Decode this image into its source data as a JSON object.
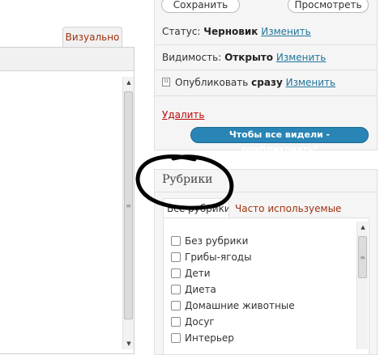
{
  "editor": {
    "tab_visual": "Визуально"
  },
  "publish": {
    "save_label": "Сохранить",
    "preview_label": "Просмотреть",
    "status_label": "Статус:",
    "status_value": "Черновик",
    "status_edit": "Изменить",
    "visibility_label": "Видимость:",
    "visibility_value": "Открыто",
    "visibility_edit": "Изменить",
    "publish_label": "Опубликовать",
    "publish_value": "сразу",
    "publish_edit": "Изменить",
    "delete_label": "Удалить",
    "publish_button": "Чтобы все видели - опубликовать!"
  },
  "categories": {
    "title": "Рубрики",
    "tab_all": "Все рубрики",
    "tab_popular": "Часто используемые",
    "items": [
      {
        "label": "Без рубрики"
      },
      {
        "label": "Грибы-ягоды"
      },
      {
        "label": "Дети"
      },
      {
        "label": "Диета"
      },
      {
        "label": "Домашние животные"
      },
      {
        "label": "Досуг"
      },
      {
        "label": "Интерьер"
      }
    ]
  },
  "colors": {
    "accent_link": "#21759b",
    "publish_button": "#2885b5",
    "delete_link": "#bc0b0b",
    "marker": "#000000"
  }
}
